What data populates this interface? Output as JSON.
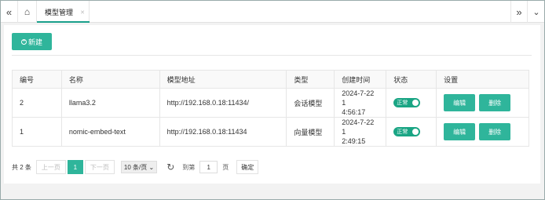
{
  "tabs": {
    "active_label": "模型管理"
  },
  "toolbar": {
    "new_label": "新建"
  },
  "table": {
    "headers": [
      "编号",
      "名称",
      "模型地址",
      "类型",
      "创建时间",
      "状态",
      "设置"
    ],
    "rows": [
      {
        "id": "2",
        "name": "llama3.2",
        "url": "http://192.168.0.18:11434/",
        "type": "会话模型",
        "created_line1": "2024-7-22 1",
        "created_line2": "4:56:17",
        "status": "正常",
        "edit": "编辑",
        "delete": "删除"
      },
      {
        "id": "1",
        "name": "nomic-embed-text",
        "url": "http://192.168.0.18:11434",
        "type": "向量模型",
        "created_line1": "2024-7-22 1",
        "created_line2": "2:49:15",
        "status": "正常",
        "edit": "编辑",
        "delete": "删除"
      }
    ]
  },
  "pagination": {
    "total": "共 2 条",
    "prev": "上一页",
    "current_page": "1",
    "next": "下一页",
    "page_size": "10 条/页",
    "goto_label": "到第",
    "goto_value": "1",
    "page_unit": "页",
    "confirm": "确定"
  },
  "colors": {
    "accent": "#2fb59b",
    "toggle_on": "#1aa584"
  }
}
